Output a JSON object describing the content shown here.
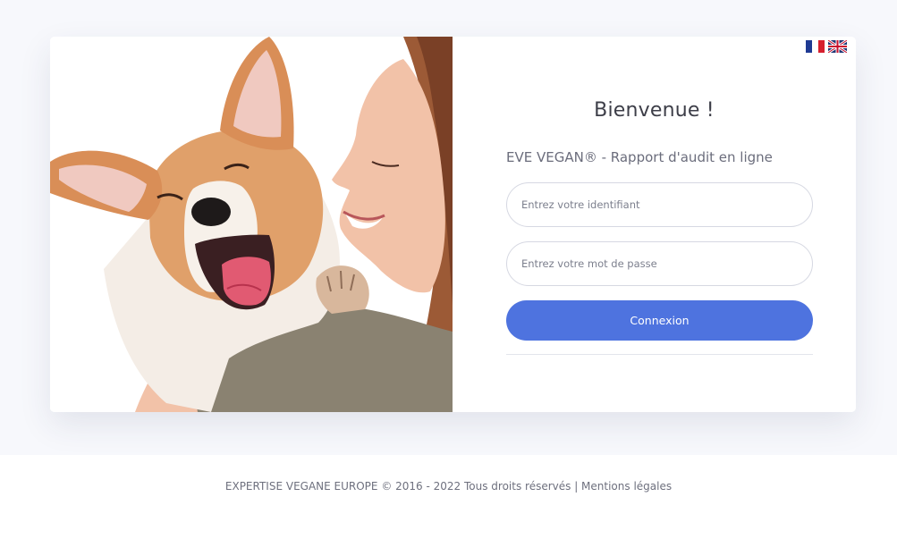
{
  "flags": {
    "fr_icon": "france-flag-icon",
    "en_icon": "uk-flag-icon"
  },
  "login": {
    "title": "Bienvenue !",
    "subtitle": "EVE VEGAN® - Rapport d'audit en ligne",
    "username_placeholder": "Entrez votre identifiant",
    "password_placeholder": "Entrez votre mot de passe",
    "submit_label": "Connexion"
  },
  "footer": {
    "copyright": "EXPERTISE VEGANE EUROPE © 2016 - 2022 Tous droits réservés",
    "separator": " | ",
    "legal_link": "Mentions légales"
  },
  "colors": {
    "page_background": "#f7f8fc",
    "primary_button": "#4e73df",
    "text_dark": "#3d3e48",
    "text_muted": "#6e707e"
  }
}
